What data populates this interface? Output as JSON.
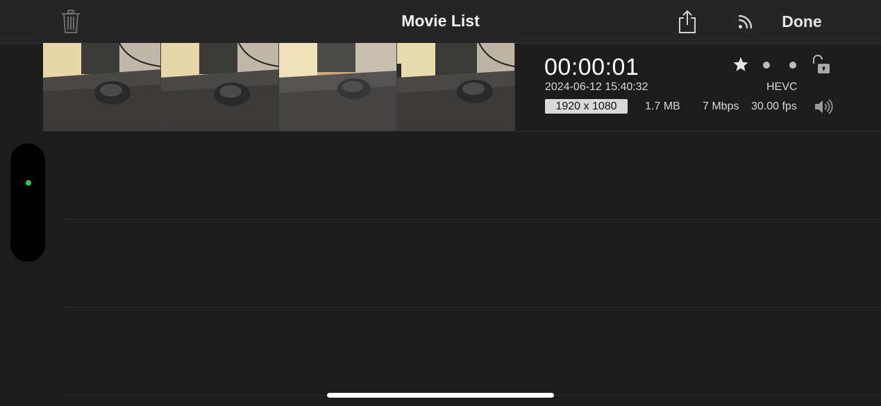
{
  "nav": {
    "title": "Movie List",
    "done_label": "Done",
    "icons": [
      "trash-icon",
      "share-icon",
      "airplay-icon"
    ]
  },
  "movie": {
    "duration": "00:00:01",
    "datetime": "2024-06-12 15:40:32",
    "codec": "HEVC",
    "resolution": "1920 x 1080",
    "size": "1.7 MB",
    "bitrate": "7 Mbps",
    "fps": "30.00 fps",
    "icons": [
      "star-icon",
      "dot-icon",
      "dot-icon",
      "unlocked-lock-icon",
      "speaker-icon"
    ],
    "thumbnail_count": 4
  },
  "colors": {
    "background": "#1c1c1c",
    "navbar": "#252525",
    "status_dot": "#32c85a",
    "badge_bg": "#d9d9d9"
  }
}
